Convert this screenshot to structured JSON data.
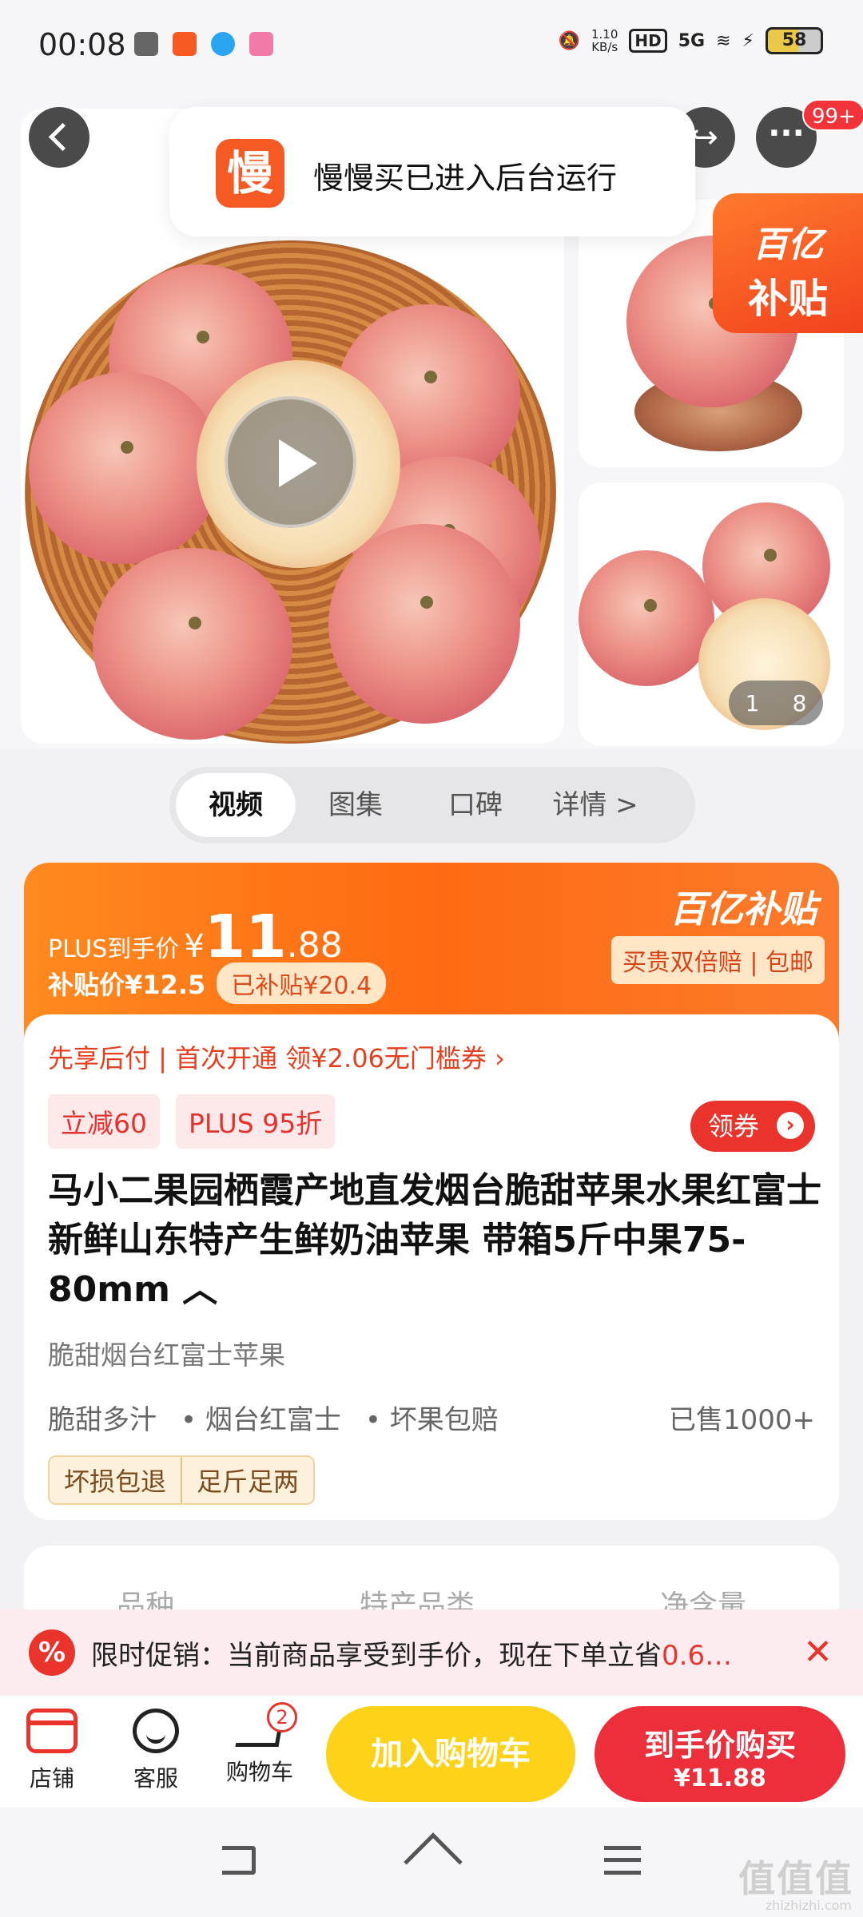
{
  "status_bar": {
    "time": "00:08",
    "net_speed_value": "1.10",
    "net_speed_unit": "KB/s",
    "hd_label": "HD",
    "signal_label": "5G",
    "battery": "58"
  },
  "toast": {
    "logo_char": "慢",
    "message": "慢慢买已进入后台运行"
  },
  "top_nav": {
    "more_badge": "99+"
  },
  "gallery": {
    "subsidy_corner_line1": "百亿",
    "subsidy_corner_line2": "补贴",
    "counter_current": "1",
    "counter_total": "8"
  },
  "tabs": [
    {
      "label": "视频",
      "active": true
    },
    {
      "label": "图集",
      "active": false
    },
    {
      "label": "口碑",
      "active": false
    },
    {
      "label": "详情 >",
      "active": false
    }
  ],
  "price": {
    "plus_label": "PLUS到手价",
    "yen": "¥",
    "integer": "11",
    "decimal": ".88",
    "subsidy_price": "补贴价¥12.5",
    "subsidy_amount": "已补贴¥20.4",
    "subsidy_logo": "百亿补贴",
    "guarantee": "买贵双倍赔 | 包邮"
  },
  "detail": {
    "credit_row": "先享后付 | 首次开通 领¥2.06无门槛券 ›",
    "promo_badges": [
      "立减60",
      "PLUS 95折"
    ],
    "coupon_button": "领券",
    "title": "马小二果园栖霞产地直发烟台脆甜苹果水果红富士新鲜山东特产生鲜奶油苹果 带箱5斤中果75-80mm ︿",
    "subtitle": "脆甜烟台红富士苹果",
    "features": [
      "脆甜多汁",
      "• 烟台红富士",
      "• 坏果包赔"
    ],
    "sold": "已售1000+",
    "service_tags": [
      "坏损包退",
      "足斤足两"
    ]
  },
  "spec_columns": [
    "品种",
    "特产品类",
    "净含量"
  ],
  "promo_banner": {
    "icon": "%",
    "text_main": "限时促销：当前商品享受到手价，现在下单立省",
    "text_highlight": "0.6…",
    "close": "✕"
  },
  "bottom_bar": {
    "store_label": "店铺",
    "service_label": "客服",
    "cart_label": "购物车",
    "cart_count": "2",
    "add_cart_label": "加入购物车",
    "buy_label": "到手价购买",
    "buy_price": "¥11.88"
  },
  "watermark": {
    "main": "值值值",
    "sub": "zhizhizhi.com"
  }
}
